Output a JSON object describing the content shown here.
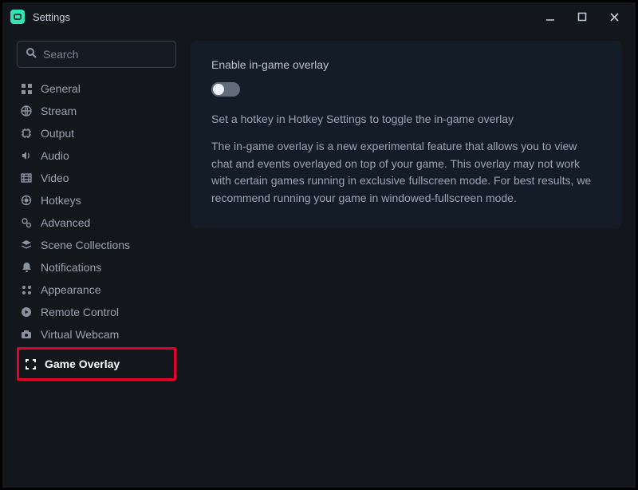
{
  "header": {
    "title": "Settings"
  },
  "search": {
    "placeholder": "Search"
  },
  "sidebar": {
    "items": [
      {
        "label": "General",
        "icon": "grid-icon"
      },
      {
        "label": "Stream",
        "icon": "globe-icon"
      },
      {
        "label": "Output",
        "icon": "chip-icon"
      },
      {
        "label": "Audio",
        "icon": "speaker-icon"
      },
      {
        "label": "Video",
        "icon": "film-icon"
      },
      {
        "label": "Hotkeys",
        "icon": "keyboard-icon"
      },
      {
        "label": "Advanced",
        "icon": "gears-icon"
      },
      {
        "label": "Scene Collections",
        "icon": "layers-icon"
      },
      {
        "label": "Notifications",
        "icon": "bell-icon"
      },
      {
        "label": "Appearance",
        "icon": "palette-icon"
      },
      {
        "label": "Remote Control",
        "icon": "remote-icon"
      },
      {
        "label": "Virtual Webcam",
        "icon": "camera-icon"
      },
      {
        "label": "Game Overlay",
        "icon": "overlay-icon"
      }
    ]
  },
  "panel": {
    "enable_label": "Enable in-game overlay",
    "enabled": false,
    "hint": "Set a hotkey in Hotkey Settings to toggle the in-game overlay",
    "description": "The in-game overlay is a new experimental feature that allows you to view chat and events overlayed on top of your game. This overlay may not work with certain games running in exclusive fullscreen mode. For best results, we recommend running your game in windowed-fullscreen mode."
  }
}
